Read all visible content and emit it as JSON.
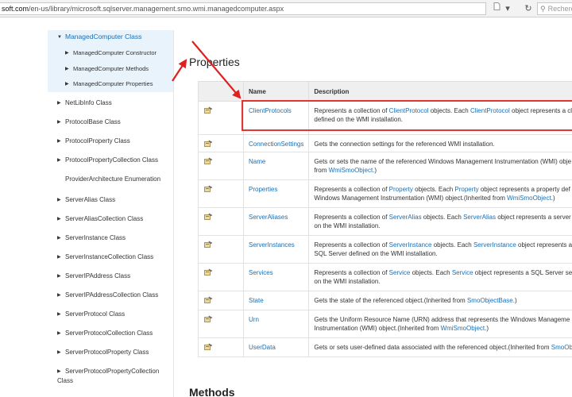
{
  "browser": {
    "url_host": "soft.com",
    "url_path": "/en-us/library/microsoft.sqlserver.management.smo.wmi.managedcomputer.aspx",
    "search_placeholder": "Recherc",
    "icons": [
      "document-icon",
      "reload-icon",
      "search-icon"
    ]
  },
  "sidebar": {
    "active_item": "ManagedComputer Class",
    "sub_items": [
      "ManagedComputer Constructor",
      "ManagedComputer Methods",
      "ManagedComputer Properties"
    ],
    "items": [
      "NetLibInfo Class",
      "ProtocolBase Class",
      "ProtocolProperty Class",
      "ProtocolPropertyCollection Class",
      "ProviderArchitecture Enumeration",
      "ServerAlias Class",
      "ServerAliasCollection Class",
      "ServerInstance Class",
      "ServerInstanceCollection Class",
      "ServerIPAddress Class",
      "ServerIPAddressCollection Class",
      "ServerProtocol Class",
      "ServerProtocolCollection Class",
      "ServerProtocolProperty Class",
      "ServerProtocolPropertyCollection Class"
    ]
  },
  "main": {
    "properties_heading": "Properties",
    "methods_heading": "Methods",
    "columns": [
      "",
      "Name",
      "Description"
    ],
    "rows": [
      {
        "name": "ClientProtocols",
        "desc": [
          {
            "t": "Represents a collection of "
          },
          {
            "l": "ClientProtocol"
          },
          {
            "t": " objects. Each "
          },
          {
            "l": "ClientProtocol"
          },
          {
            "t": " object represents a cli"
          },
          {
            "br": true
          },
          {
            "t": "defined on the WMI installation."
          }
        ]
      },
      {
        "name": "ConnectionSettings",
        "desc": [
          {
            "t": "Gets the connection settings for the referenced WMI installation."
          }
        ]
      },
      {
        "name": "Name",
        "desc": [
          {
            "t": "Gets or sets the name of the referenced Windows Management Instrumentation (WMI) obje"
          },
          {
            "br": true
          },
          {
            "t": "from "
          },
          {
            "l": "WmiSmoObject"
          },
          {
            "t": ".)"
          }
        ]
      },
      {
        "name": "Properties",
        "desc": [
          {
            "t": "Represents a collection of "
          },
          {
            "l": "Property"
          },
          {
            "t": " objects. Each "
          },
          {
            "l": "Property"
          },
          {
            "t": " object represents a property def"
          },
          {
            "br": true
          },
          {
            "t": "Windows Management Instrumentation (WMI) object.(Inherited from "
          },
          {
            "l": "WmiSmoObject"
          },
          {
            "t": ".)"
          }
        ]
      },
      {
        "name": "ServerAliases",
        "desc": [
          {
            "t": "Represents a collection of "
          },
          {
            "l": "ServerAlias"
          },
          {
            "t": " objects. Each "
          },
          {
            "l": "ServerAlias"
          },
          {
            "t": " object represents a server a"
          },
          {
            "br": true
          },
          {
            "t": "on the WMI installation."
          }
        ]
      },
      {
        "name": "ServerInstances",
        "desc": [
          {
            "t": "Represents a collection of "
          },
          {
            "l": "ServerInstance"
          },
          {
            "t": " objects. Each "
          },
          {
            "l": "ServerInstance"
          },
          {
            "t": " object represents an"
          },
          {
            "br": true
          },
          {
            "t": "SQL Server defined on the WMI installation."
          }
        ]
      },
      {
        "name": "Services",
        "desc": [
          {
            "t": "Represents a collection of "
          },
          {
            "l": "Service"
          },
          {
            "t": " objects. Each "
          },
          {
            "l": "Service"
          },
          {
            "t": " object represents a SQL Server serv"
          },
          {
            "br": true
          },
          {
            "t": "on the WMI installation."
          }
        ]
      },
      {
        "name": "State",
        "desc": [
          {
            "t": "Gets the state of the referenced object.(Inherited from "
          },
          {
            "l": "SmoObjectBase"
          },
          {
            "t": ".)"
          }
        ]
      },
      {
        "name": "Urn",
        "desc": [
          {
            "t": "Gets the Uniform Resource Name (URN) address that represents the Windows Manageme"
          },
          {
            "br": true
          },
          {
            "t": "Instrumentation (WMI) object.(Inherited from "
          },
          {
            "l": "WmiSmoObject"
          },
          {
            "t": ".)"
          }
        ]
      },
      {
        "name": "UserData",
        "desc": [
          {
            "t": "Gets or sets user-defined data associated with the referenced object.(Inherited from "
          },
          {
            "l": "SmoOb"
          }
        ]
      }
    ]
  },
  "annotations": {
    "color": "#e02020"
  },
  "colors": {
    "link": "#1a6fb5",
    "selected_bg": "#e9f3fb",
    "header_bg": "#efefef"
  }
}
